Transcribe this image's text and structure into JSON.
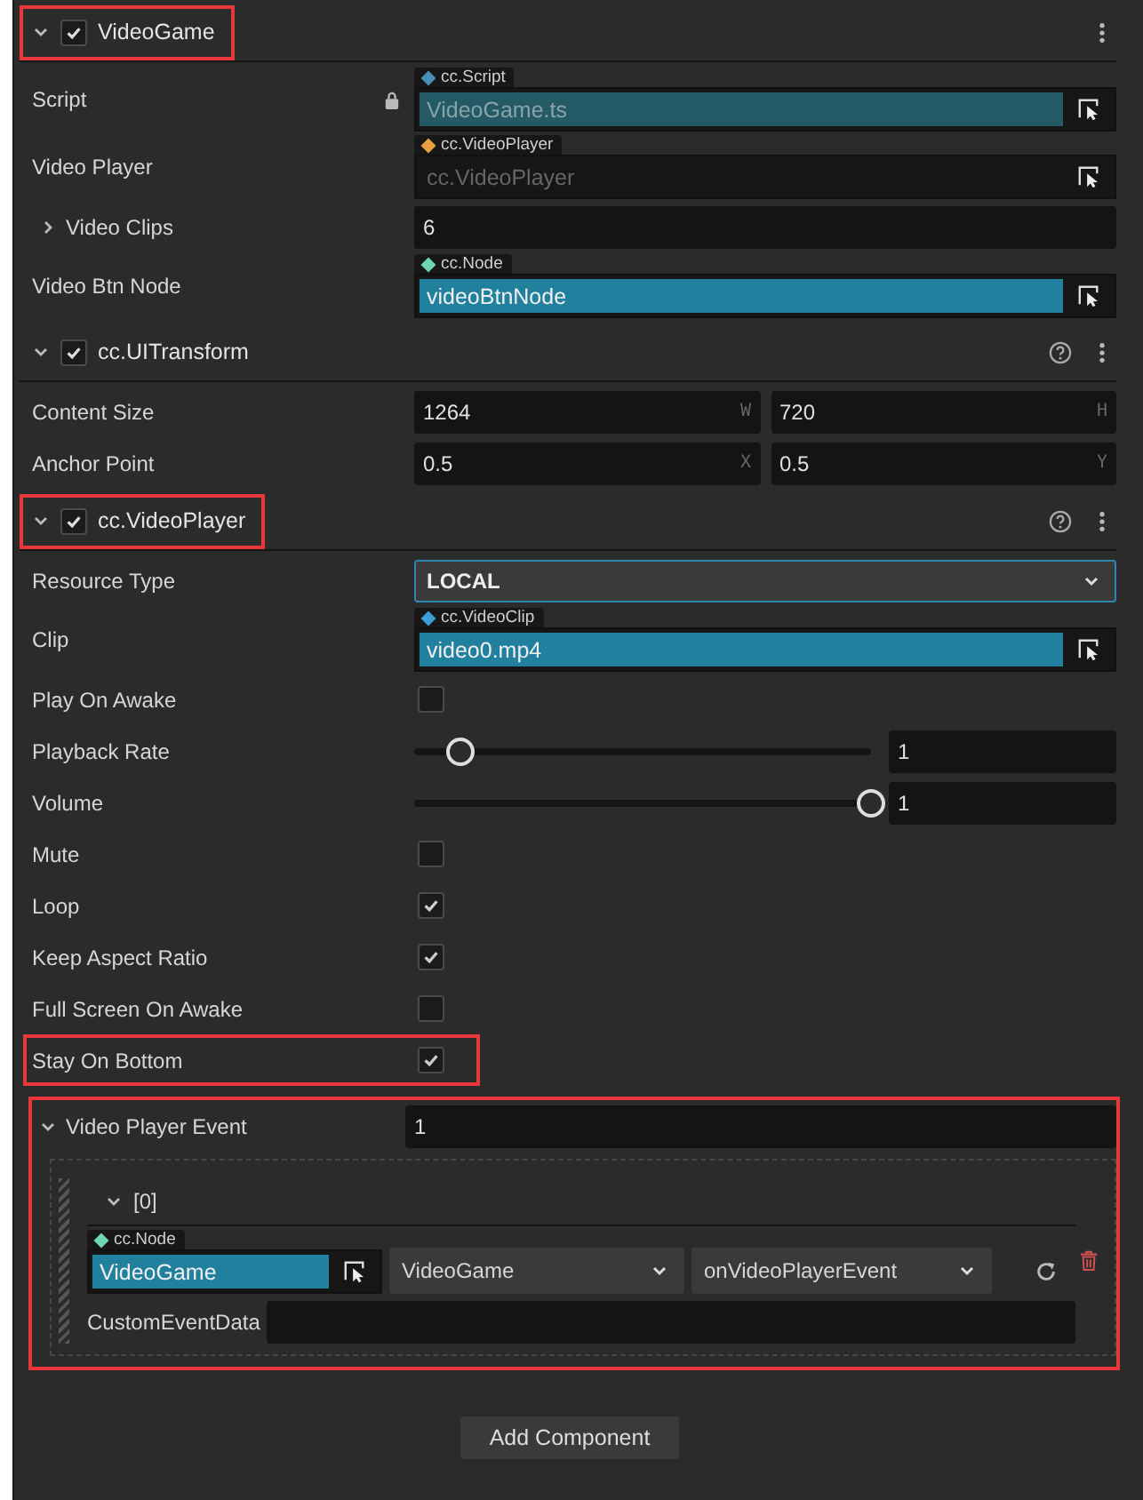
{
  "components": [
    {
      "title": "VideoGame",
      "enabled": true,
      "expanded": true,
      "highlighted": true,
      "props": [
        {
          "kind": "asset",
          "label": "Script",
          "locked": true,
          "type": "cc.Script",
          "color": "#4a8db5",
          "value": "VideoGame.ts",
          "readonly": true
        },
        {
          "kind": "asset",
          "label": "Video Player",
          "type": "cc.VideoPlayer",
          "color": "#e8a040",
          "placeholder": "cc.VideoPlayer"
        },
        {
          "kind": "array",
          "label": "Video Clips",
          "expanded": false,
          "value": "6"
        },
        {
          "kind": "asset",
          "label": "Video Btn Node",
          "type": "cc.Node",
          "color": "#6fd6b2",
          "value": "videoBtnNode"
        }
      ]
    },
    {
      "title": "cc.UITransform",
      "enabled": true,
      "expanded": true,
      "help": true,
      "props": [
        {
          "kind": "vec2",
          "label": "Content Size",
          "fields": [
            {
              "value": "1264",
              "axis": "W"
            },
            {
              "value": "720",
              "axis": "H"
            }
          ]
        },
        {
          "kind": "vec2",
          "label": "Anchor Point",
          "fields": [
            {
              "value": "0.5",
              "axis": "X"
            },
            {
              "value": "0.5",
              "axis": "Y"
            }
          ]
        }
      ]
    },
    {
      "title": "cc.VideoPlayer",
      "enabled": true,
      "expanded": true,
      "highlighted": true,
      "help": true,
      "props": [
        {
          "kind": "select",
          "label": "Resource Type",
          "value": "LOCAL",
          "focused": true
        },
        {
          "kind": "asset",
          "label": "Clip",
          "type": "cc.VideoClip",
          "color": "#3a9fd6",
          "value": "video0.mp4"
        },
        {
          "kind": "check",
          "label": "Play On Awake",
          "checked": false
        },
        {
          "kind": "slider",
          "label": "Playback Rate",
          "level": 0.1,
          "value": "1"
        },
        {
          "kind": "slider",
          "label": "Volume",
          "level": 1,
          "value": "1"
        },
        {
          "kind": "check",
          "label": "Mute",
          "checked": false
        },
        {
          "kind": "check",
          "label": "Loop",
          "checked": true
        },
        {
          "kind": "check",
          "label": "Keep Aspect Ratio",
          "checked": true
        },
        {
          "kind": "check",
          "label": "Full Screen On Awake",
          "checked": false
        },
        {
          "kind": "check",
          "label": "Stay On Bottom",
          "checked": true,
          "highlighted": true
        },
        {
          "kind": "events",
          "label": "Video Player Event",
          "expanded": true,
          "highlighted": true,
          "value": "1",
          "items": [
            {
              "label": "[0]",
              "expanded": true,
              "node": {
                "type": "cc.Node",
                "color": "#6fd6b2",
                "value": "VideoGame"
              },
              "component": "VideoGame",
              "handler": "onVideoPlayerEvent",
              "data_label": "CustomEventData"
            }
          ]
        }
      ]
    }
  ],
  "add_button": "Add Component"
}
